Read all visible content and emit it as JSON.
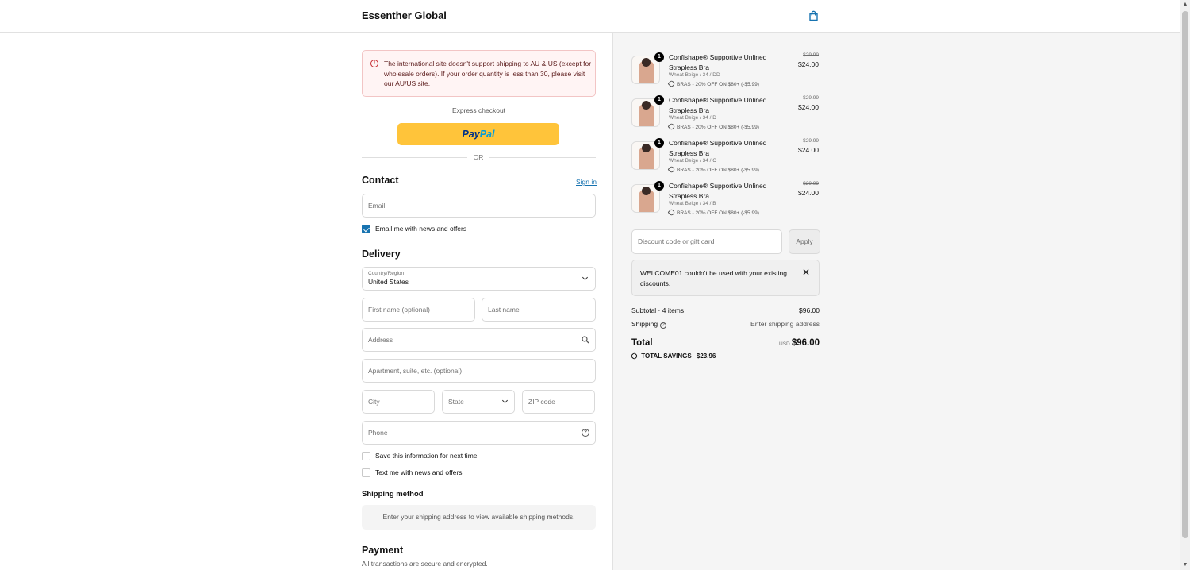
{
  "header": {
    "store_name": "Essenther Global",
    "cart_icon": "shopping-bag-icon"
  },
  "banner": {
    "icon": "alert-circle-icon",
    "text": "The international site doesn't support shipping to AU & US (except for wholesale orders). If your order quantity is less than 30, please visit our AU/US site."
  },
  "express": {
    "label": "Express checkout",
    "paypal_a": "Pay",
    "paypal_b": "Pal",
    "or_label": "OR"
  },
  "contact": {
    "title": "Contact",
    "sign_in": "Sign in",
    "email_placeholder": "Email",
    "email_news_label": "Email me with news and offers",
    "email_news_checked": true
  },
  "delivery": {
    "title": "Delivery",
    "country_label": "Country/Region",
    "country_value": "United States",
    "first_name_placeholder": "First name (optional)",
    "last_name_placeholder": "Last name",
    "address_placeholder": "Address",
    "apartment_placeholder": "Apartment, suite, etc. (optional)",
    "city_placeholder": "City",
    "state_placeholder": "State",
    "zip_placeholder": "ZIP code",
    "phone_placeholder": "Phone",
    "save_info_label": "Save this information for next time",
    "text_news_label": "Text me with news and offers"
  },
  "shipping_method": {
    "title": "Shipping method",
    "message": "Enter your shipping address to view available shipping methods."
  },
  "payment": {
    "title": "Payment",
    "subtitle": "All transactions are secure and encrypted."
  },
  "order": {
    "items": [
      {
        "qty": "1",
        "name": "Confishape® Supportive Unlined Strapless Bra",
        "variant": "Wheat Beige / 34 / DD",
        "discount": "BRAS - 20% OFF ON $80+ (-$5.99)",
        "old_price": "$29.99",
        "price": "$24.00"
      },
      {
        "qty": "1",
        "name": "Confishape® Supportive Unlined Strapless Bra",
        "variant": "Wheat Beige / 34 / D",
        "discount": "BRAS - 20% OFF ON $80+ (-$5.99)",
        "old_price": "$29.99",
        "price": "$24.00"
      },
      {
        "qty": "1",
        "name": "Confishape® Supportive Unlined Strapless Bra",
        "variant": "Wheat Beige / 34 / C",
        "discount": "BRAS - 20% OFF ON $80+ (-$5.99)",
        "old_price": "$29.99",
        "price": "$24.00"
      },
      {
        "qty": "1",
        "name": "Confishape® Supportive Unlined Strapless Bra",
        "variant": "Wheat Beige / 34 / B",
        "discount": "BRAS - 20% OFF ON $80+ (-$5.99)",
        "old_price": "$29.99",
        "price": "$24.00"
      }
    ],
    "discount_placeholder": "Discount code or gift card",
    "apply_label": "Apply",
    "notice": "WELCOME01 couldn't be used with your existing discounts.",
    "subtotal_label": "Subtotal · 4 items",
    "subtotal_value": "$96.00",
    "shipping_label": "Shipping",
    "shipping_value": "Enter shipping address",
    "total_label": "Total",
    "currency": "USD",
    "total_value": "$96.00",
    "savings_label": "TOTAL SAVINGS",
    "savings_value": "$23.96"
  },
  "colors": {
    "accent": "#1773b0",
    "paypal": "#ffc43a",
    "banner_bg": "#fff4f4",
    "error": "#c5282f"
  }
}
